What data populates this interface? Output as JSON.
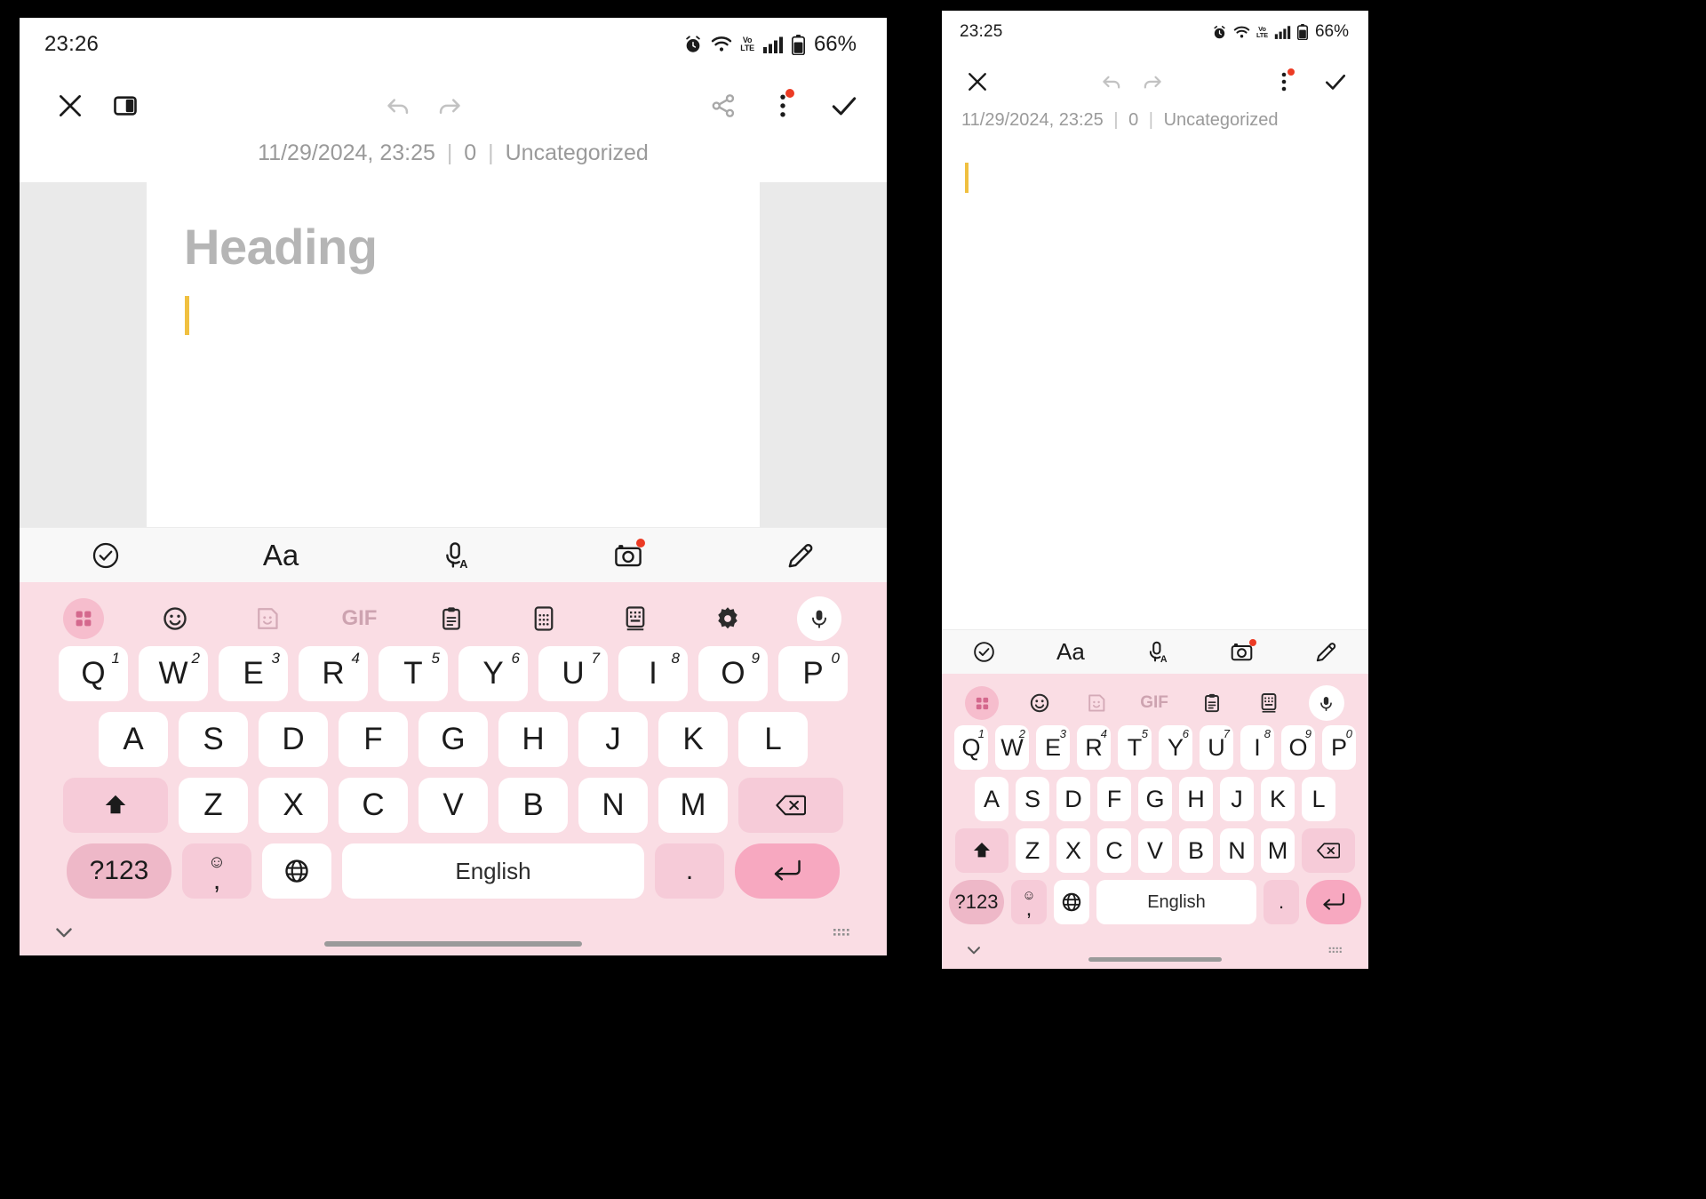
{
  "panels": [
    {
      "id": "left",
      "status": {
        "time": "23:26",
        "battery_percent": "66%",
        "network": "VoLTE",
        "icons": [
          "alarm-icon",
          "wifi-icon",
          "volte-icon",
          "signal-icon",
          "battery-icon"
        ]
      },
      "toolbar": {
        "close_label": "close-icon",
        "panel_label": "sidebar-toggle-icon",
        "undo_label": "undo-icon",
        "redo_label": "redo-icon",
        "share_label": "share-icon",
        "more_label": "more-vertical-icon",
        "done_label": "check-icon",
        "has_more_badge": true
      },
      "meta": {
        "date": "11/29/2024, 23:25",
        "count": "0",
        "category": "Uncategorized",
        "separator": "|"
      },
      "editor": {
        "heading_placeholder": "Heading",
        "body": "",
        "caret_color": "#f0c040",
        "show_heading": true,
        "show_gutter": true
      },
      "formatbar": [
        {
          "name": "checklist-circle-icon",
          "label": ""
        },
        {
          "name": "text-format-icon",
          "label": "Aa"
        },
        {
          "name": "voice-typing-icon",
          "label": ""
        },
        {
          "name": "camera-icon",
          "label": "",
          "badge": true
        },
        {
          "name": "draw-pen-icon",
          "label": ""
        }
      ],
      "keyboard": {
        "toolbar": [
          {
            "name": "grid-menu-icon",
            "active": true
          },
          {
            "name": "emoji-icon",
            "active": false
          },
          {
            "name": "sticker-icon",
            "active": false
          },
          {
            "name": "gif-icon",
            "label": "GIF",
            "active": false
          },
          {
            "name": "clipboard-icon",
            "active": false
          },
          {
            "name": "numpad-icon",
            "active": false
          },
          {
            "name": "keyboard-mode-icon",
            "active": false
          },
          {
            "name": "settings-gear-icon",
            "active": false
          },
          {
            "name": "microphone-icon",
            "active": false
          }
        ],
        "row1": [
          {
            "key": "Q",
            "sup": "1"
          },
          {
            "key": "W",
            "sup": "2"
          },
          {
            "key": "E",
            "sup": "3"
          },
          {
            "key": "R",
            "sup": "4"
          },
          {
            "key": "T",
            "sup": "5"
          },
          {
            "key": "Y",
            "sup": "6"
          },
          {
            "key": "U",
            "sup": "7"
          },
          {
            "key": "I",
            "sup": "8"
          },
          {
            "key": "O",
            "sup": "9"
          },
          {
            "key": "P",
            "sup": "0"
          }
        ],
        "row2": [
          {
            "key": "A"
          },
          {
            "key": "S"
          },
          {
            "key": "D"
          },
          {
            "key": "F"
          },
          {
            "key": "G"
          },
          {
            "key": "H"
          },
          {
            "key": "J"
          },
          {
            "key": "K"
          },
          {
            "key": "L"
          }
        ],
        "row3": [
          {
            "key": "Z"
          },
          {
            "key": "X"
          },
          {
            "key": "C"
          },
          {
            "key": "V"
          },
          {
            "key": "B"
          },
          {
            "key": "N"
          },
          {
            "key": "M"
          }
        ],
        "shift_label": "shift-icon",
        "backspace_label": "backspace-icon",
        "symbols_label": "?123",
        "comma_label": ",",
        "comma_emoji": "☺",
        "globe_label": "globe-icon",
        "space_label": "English",
        "period_label": ".",
        "enter_label": "enter-icon"
      },
      "navbar": {
        "collapse_label": "chevron-down-icon",
        "resize_label": "keyboard-resize-icon"
      }
    },
    {
      "id": "right",
      "status": {
        "time": "23:25",
        "battery_percent": "66%",
        "network": "VoLTE",
        "icons": [
          "alarm-icon",
          "wifi-icon",
          "volte-icon",
          "signal-icon",
          "battery-icon"
        ]
      },
      "toolbar": {
        "close_label": "close-icon",
        "undo_label": "undo-icon",
        "redo_label": "redo-icon",
        "more_label": "more-vertical-icon",
        "done_label": "check-icon",
        "has_more_badge": true
      },
      "meta": {
        "date": "11/29/2024, 23:25",
        "count": "0",
        "category": "Uncategorized",
        "separator": "|"
      },
      "editor": {
        "heading_placeholder": "",
        "body": "",
        "caret_color": "#f0c040",
        "show_heading": false,
        "show_gutter": false
      },
      "formatbar": [
        {
          "name": "checklist-circle-icon",
          "label": ""
        },
        {
          "name": "text-format-icon",
          "label": "Aa"
        },
        {
          "name": "voice-typing-icon",
          "label": ""
        },
        {
          "name": "camera-icon",
          "label": "",
          "badge": true
        },
        {
          "name": "draw-pen-icon",
          "label": ""
        }
      ],
      "keyboard": {
        "toolbar": [
          {
            "name": "grid-menu-icon",
            "active": true
          },
          {
            "name": "emoji-icon",
            "active": false
          },
          {
            "name": "sticker-icon",
            "active": false
          },
          {
            "name": "gif-icon",
            "label": "GIF",
            "active": false
          },
          {
            "name": "clipboard-icon",
            "active": false
          },
          {
            "name": "numpad-icon",
            "active": false
          },
          {
            "name": "microphone-icon",
            "active": false
          }
        ],
        "row1": [
          {
            "key": "Q",
            "sup": "1"
          },
          {
            "key": "W",
            "sup": "2"
          },
          {
            "key": "E",
            "sup": "3"
          },
          {
            "key": "R",
            "sup": "4"
          },
          {
            "key": "T",
            "sup": "5"
          },
          {
            "key": "Y",
            "sup": "6"
          },
          {
            "key": "U",
            "sup": "7"
          },
          {
            "key": "I",
            "sup": "8"
          },
          {
            "key": "O",
            "sup": "9"
          },
          {
            "key": "P",
            "sup": "0"
          }
        ],
        "row2": [
          {
            "key": "A"
          },
          {
            "key": "S"
          },
          {
            "key": "D"
          },
          {
            "key": "F"
          },
          {
            "key": "G"
          },
          {
            "key": "H"
          },
          {
            "key": "J"
          },
          {
            "key": "K"
          },
          {
            "key": "L"
          }
        ],
        "row3": [
          {
            "key": "Z"
          },
          {
            "key": "X"
          },
          {
            "key": "C"
          },
          {
            "key": "V"
          },
          {
            "key": "B"
          },
          {
            "key": "N"
          },
          {
            "key": "M"
          }
        ],
        "shift_label": "shift-icon",
        "backspace_label": "backspace-icon",
        "symbols_label": "?123",
        "comma_label": ",",
        "comma_emoji": "☺",
        "globe_label": "globe-icon",
        "space_label": "English",
        "period_label": ".",
        "enter_label": "enter-icon"
      },
      "navbar": {
        "collapse_label": "chevron-down-icon",
        "resize_label": "keyboard-resize-icon"
      }
    }
  ],
  "theme": {
    "keyboard_bg": "#fadde4",
    "key_bg": "#ffffff",
    "accent_pink": "#f6bdcd",
    "enter_pink": "#f7a8c0",
    "badge_red": "#ec3b24",
    "caret_yellow": "#f0c040",
    "gutter_grey": "#eaeaea",
    "meta_grey": "#9a9a9a",
    "page_bg": "#000000"
  }
}
